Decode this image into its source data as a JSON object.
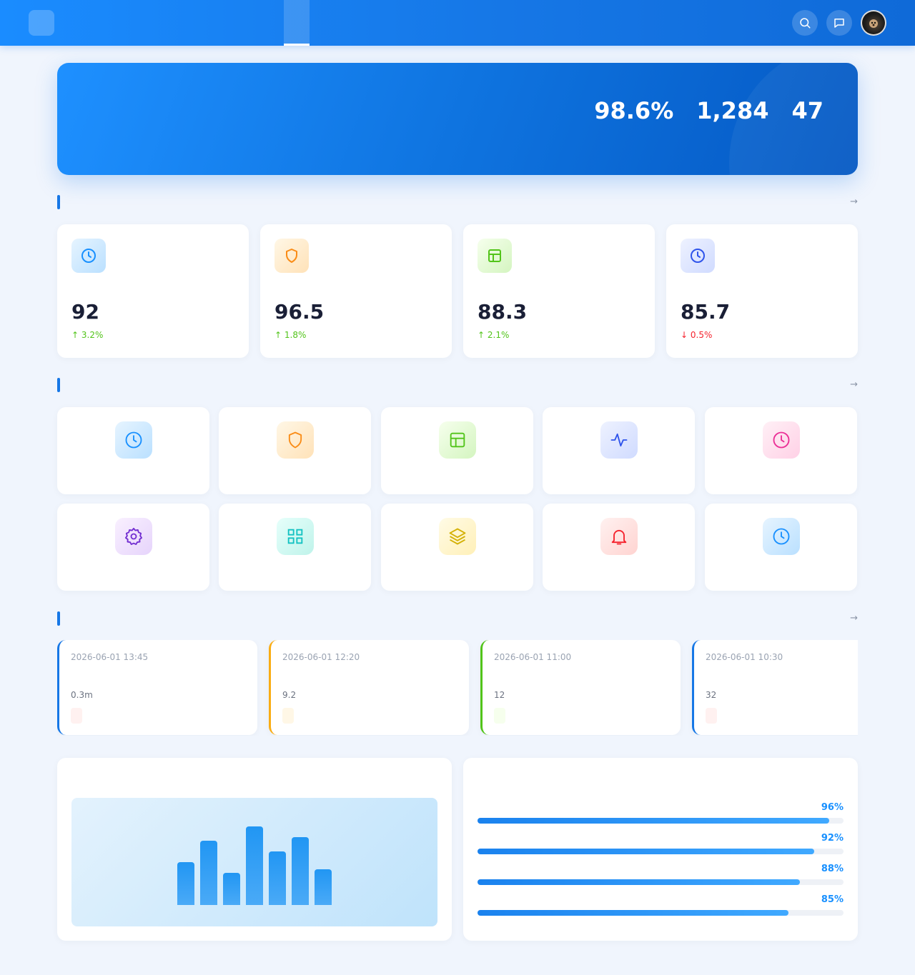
{
  "header": {
    "logo_glyph": "",
    "brand_title": "",
    "nav": [
      {
        "label": "",
        "active": true
      },
      {
        "label": ""
      },
      {
        "label": ""
      },
      {
        "label": ""
      },
      {
        "label": ""
      },
      {
        "label": ""
      },
      {
        "label": ""
      }
    ],
    "icons": [
      "search-icon",
      "message-icon",
      "avatar"
    ]
  },
  "hero": {
    "title": " ",
    "subtitle": "",
    "stats": [
      {
        "value": "98.6%",
        "label": ""
      },
      {
        "value": "1,284",
        "label": ""
      },
      {
        "value": "47",
        "label": ""
      }
    ]
  },
  "overview": {
    "title": "",
    "more": " →",
    "cards": [
      {
        "icon": "clock-icon",
        "label": "",
        "value": "92",
        "delta": "↑ 3.2% ",
        "trend": "up",
        "color": "#1890ff"
      },
      {
        "icon": "shield-icon",
        "label": "",
        "value": "96.5",
        "delta": "↑ 1.8% ",
        "trend": "up",
        "color": "#fa8c16"
      },
      {
        "icon": "layout-icon",
        "label": "",
        "value": "88.3",
        "delta": "↑ 2.1% ",
        "trend": "up",
        "color": "#52c41a"
      },
      {
        "icon": "clock-icon",
        "label": "",
        "value": "85.7",
        "delta": "↓ 0.5% ",
        "trend": "down",
        "color": "#2f54eb"
      }
    ]
  },
  "functions": {
    "title": "",
    "more": " →",
    "items": [
      {
        "icon": "clock-icon",
        "label": "",
        "color": "#1890ff"
      },
      {
        "icon": "shield-icon",
        "label": "",
        "color": "#fa8c16"
      },
      {
        "icon": "layout-icon",
        "label": "",
        "color": "#52c41a"
      },
      {
        "icon": "activity-icon",
        "label": "",
        "color": "#2f54eb"
      },
      {
        "icon": "clock-icon",
        "label": "",
        "color": "#eb2f96"
      },
      {
        "icon": "settings-icon",
        "label": "",
        "color": "#722ed1"
      },
      {
        "icon": "grid-icon",
        "label": "",
        "color": "#13c2c2"
      },
      {
        "icon": "layers-icon",
        "label": "",
        "color": "#d4b106"
      },
      {
        "icon": "bell-icon",
        "label": "",
        "color": "#f5222d"
      },
      {
        "icon": "clock-icon",
        "label": "",
        "color": "#1890ff"
      }
    ]
  },
  "alerts": {
    "title": "",
    "more": " →",
    "items": [
      {
        "time": "2026-06-01 13:45",
        "title": " ",
        "desc": "0.3m",
        "tag": "",
        "color": "#1677e6",
        "tag_color": "#f5222d",
        "tag_bg": "#fff1f0"
      },
      {
        "time": "2026-06-01 12:20",
        "title": " ",
        "desc": "9.2",
        "tag": "",
        "color": "#faad14",
        "tag_color": "#fa8c16",
        "tag_bg": "#fff7e6"
      },
      {
        "time": "2026-06-01 11:00",
        "title": " ",
        "desc": "12",
        "tag": "",
        "color": "#52c41a",
        "tag_color": "#52c41a",
        "tag_bg": "#f6ffed"
      },
      {
        "time": "2026-06-01 10:30",
        "title": " ",
        "desc": "32",
        "tag": "",
        "color": "#1677e6",
        "tag_color": "#f5222d",
        "tag_bg": "#fff1f0"
      }
    ]
  },
  "chart_panel": {
    "title": " ",
    "chart_data": {
      "type": "bar",
      "categories": [
        "",
        "",
        "",
        "",
        "",
        "",
        ""
      ],
      "values": [
        60,
        90,
        45,
        110,
        75,
        95,
        50
      ],
      "ylim": [
        0,
        130
      ],
      "grid": false
    }
  },
  "progress_panel": {
    "title": " ",
    "items": [
      {
        "label": "",
        "value": "96%",
        "fraction": 0.96
      },
      {
        "label": "",
        "value": "92%",
        "fraction": 0.92
      },
      {
        "label": "",
        "value": "88%",
        "fraction": 0.88
      },
      {
        "label": "",
        "value": "85%",
        "fraction": 0.85
      }
    ]
  }
}
